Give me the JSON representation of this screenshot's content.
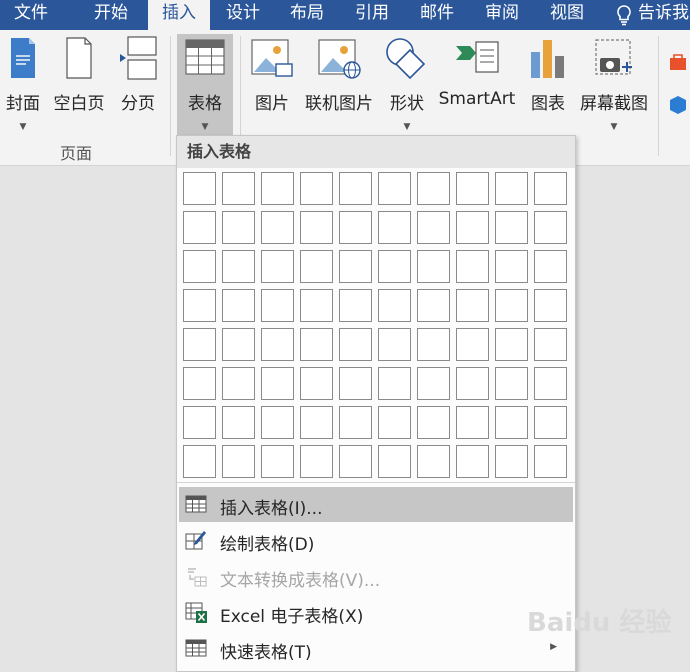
{
  "tabs": [
    {
      "label": "文件",
      "active": false
    },
    {
      "label": "开始",
      "active": false
    },
    {
      "label": "插入",
      "active": true
    },
    {
      "label": "设计",
      "active": false
    },
    {
      "label": "布局",
      "active": false
    },
    {
      "label": "引用",
      "active": false
    },
    {
      "label": "邮件",
      "active": false
    },
    {
      "label": "审阅",
      "active": false
    },
    {
      "label": "视图",
      "active": false
    }
  ],
  "tell_me": {
    "label": "告诉我",
    "icon": "lightbulb-icon"
  },
  "ribbon": {
    "pages_group": {
      "label": "页面",
      "buttons": [
        {
          "label": "封面",
          "icon": "cover-page-icon",
          "has_dropdown": true
        },
        {
          "label": "空白页",
          "icon": "blank-page-icon",
          "has_dropdown": false
        },
        {
          "label": "分页",
          "icon": "page-break-icon",
          "has_dropdown": false
        }
      ]
    },
    "table_button": {
      "label": "表格",
      "icon": "table-icon",
      "has_dropdown": true,
      "pressed": true
    },
    "illustrations": [
      {
        "label": "图片",
        "icon": "picture-icon",
        "has_dropdown": false
      },
      {
        "label": "联机图片",
        "icon": "online-picture-icon",
        "has_dropdown": false
      },
      {
        "label": "形状",
        "icon": "shapes-icon",
        "has_dropdown": true
      },
      {
        "label": "SmartArt",
        "icon": "smartart-icon",
        "has_dropdown": false
      },
      {
        "label": "图表",
        "icon": "chart-icon",
        "has_dropdown": false
      },
      {
        "label": "屏幕截图",
        "icon": "screenshot-icon",
        "has_dropdown": true
      }
    ]
  },
  "dropdown": {
    "header": "插入表格",
    "grid": {
      "columns": 10,
      "rows": 8
    },
    "menu_items": [
      {
        "label": "插入表格(I)...",
        "icon": "insert-table-icon",
        "enabled": true,
        "highlighted": true
      },
      {
        "label": "绘制表格(D)",
        "icon": "draw-table-icon",
        "enabled": true,
        "highlighted": false
      },
      {
        "label": "文本转换成表格(V)...",
        "icon": "text-to-table-icon",
        "enabled": false,
        "highlighted": false
      },
      {
        "label": "Excel 电子表格(X)",
        "icon": "excel-spreadsheet-icon",
        "enabled": true,
        "highlighted": false
      },
      {
        "label": "快速表格(T)",
        "icon": "quick-tables-icon",
        "enabled": true,
        "highlighted": false,
        "has_submenu": true
      }
    ]
  },
  "watermark": {
    "text": "Baidu 经验"
  },
  "colors": {
    "accent": "#2b579a",
    "ribbon_bg": "#f3f3f3",
    "menu_highlight": "#c6c6c6",
    "disabled_text": "#a6a6a6"
  }
}
